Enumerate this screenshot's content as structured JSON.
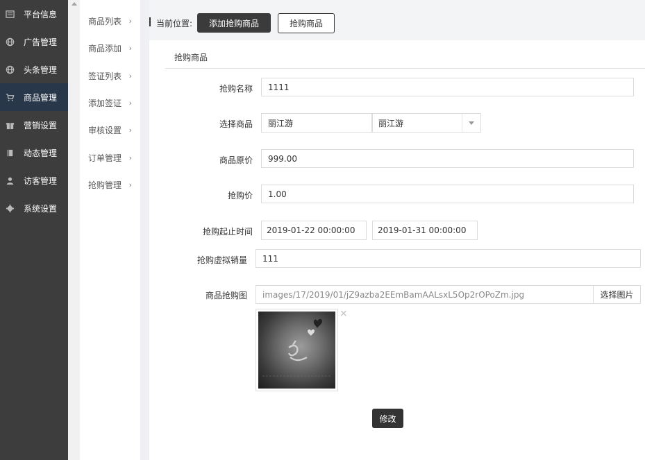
{
  "sidebar": {
    "items": [
      {
        "label": "平台信息",
        "icon": "newspaper-icon"
      },
      {
        "label": "广告管理",
        "icon": "globe-icon"
      },
      {
        "label": "头条管理",
        "icon": "globe-icon"
      },
      {
        "label": "商品管理",
        "icon": "cart-icon",
        "active": true
      },
      {
        "label": "营销设置",
        "icon": "gift-icon"
      },
      {
        "label": "动态管理",
        "icon": "book-icon"
      },
      {
        "label": "访客管理",
        "icon": "user-icon"
      },
      {
        "label": "系统设置",
        "icon": "gear-icon"
      }
    ]
  },
  "submenu": {
    "items": [
      {
        "label": "商品列表"
      },
      {
        "label": "商品添加"
      },
      {
        "label": "签证列表"
      },
      {
        "label": "添加签证"
      },
      {
        "label": "审核设置"
      },
      {
        "label": "订单管理"
      },
      {
        "label": "抢购管理"
      }
    ],
    "chevron": "›"
  },
  "header": {
    "location_label": "当前位置:",
    "active_button": "添加抢购商品",
    "secondary_button": "抢购商品"
  },
  "form": {
    "section_title": "抢购商品",
    "name_label": "抢购名称",
    "name_value": "1111",
    "product_label": "选择商品",
    "product_value": "丽江游",
    "product_select_value": "丽江游",
    "original_price_label": "商品原价",
    "original_price_value": "999.00",
    "flash_price_label": "抢购价",
    "flash_price_value": "1.00",
    "time_label": "抢购起止时间",
    "start_time": "2019-01-22 00:00:00",
    "end_time": "2019-01-31 00:00:00",
    "virtual_sales_label": "抢购虚拟销量",
    "virtual_sales_value": "111",
    "image_label": "商品抢购图",
    "image_path": "images/17/2019/01/jZ9azba2EEmBamAALsxL5Op2rOPoZm.jpg",
    "pick_image_button": "选择图片",
    "thumb_close": "×",
    "submit_button": "修改"
  },
  "colors": {
    "sidebar_bg": "#3d3d3d",
    "sidebar_active": "#28374a",
    "dark_button": "#3b3b3b"
  }
}
